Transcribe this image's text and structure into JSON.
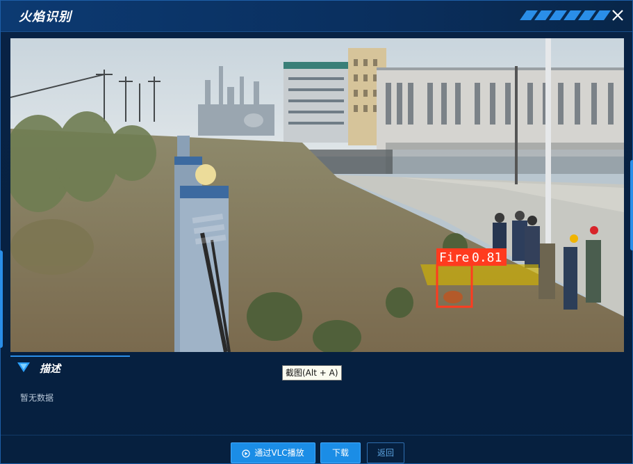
{
  "window": {
    "title": "火焰识别"
  },
  "detection": {
    "label": "Fire",
    "score": "0.81",
    "box_color": "#ff3b1f"
  },
  "description": {
    "heading": "描述",
    "empty_text": "暂无数据"
  },
  "tooltip": {
    "text": "截图(Alt + A)"
  },
  "footer": {
    "vlc_label": "通过VLC播放",
    "download_label": "下载",
    "back_label": "返回"
  },
  "colors": {
    "accent": "#1b8de6",
    "background": "#061a33"
  }
}
